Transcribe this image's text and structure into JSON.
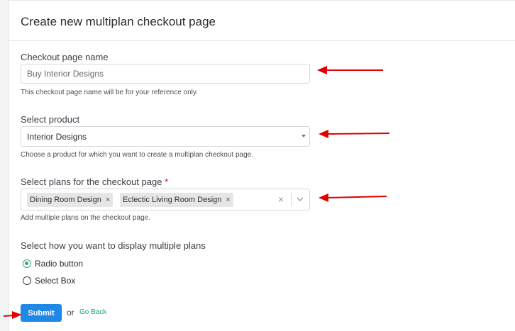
{
  "header": {
    "title": "Create new multiplan checkout page"
  },
  "form": {
    "page_name": {
      "label": "Checkout page name",
      "value": "Buy Interior Designs",
      "help": "This checkout page name will be for your reference only."
    },
    "product": {
      "label": "Select product",
      "value": "Interior Designs",
      "help": "Choose a product for which you want to create a multiplan checkout page."
    },
    "plans": {
      "label": "Select plans for the checkout page",
      "required_mark": "*",
      "tags": [
        "Dining Room Design",
        "Eclectic Living Room Design"
      ],
      "tag_remove": "×",
      "clear": "×",
      "help": "Add multiple plans on the checkout page."
    },
    "display": {
      "label": "Select how you want to display multiple plans",
      "options": [
        "Radio button",
        "Select Box"
      ],
      "selected": "Radio button"
    }
  },
  "actions": {
    "submit_label": "Submit",
    "or_text": "or",
    "go_back_label": "Go Back"
  },
  "colors": {
    "accent_blue": "#1e88e5",
    "accent_green": "#3aa181",
    "annotation_arrow": "#e00000"
  },
  "icons": {
    "caret": "caret-down-icon",
    "chevron": "chevron-down-icon",
    "clear": "close-icon",
    "annotation": "red-arrow-icon"
  }
}
